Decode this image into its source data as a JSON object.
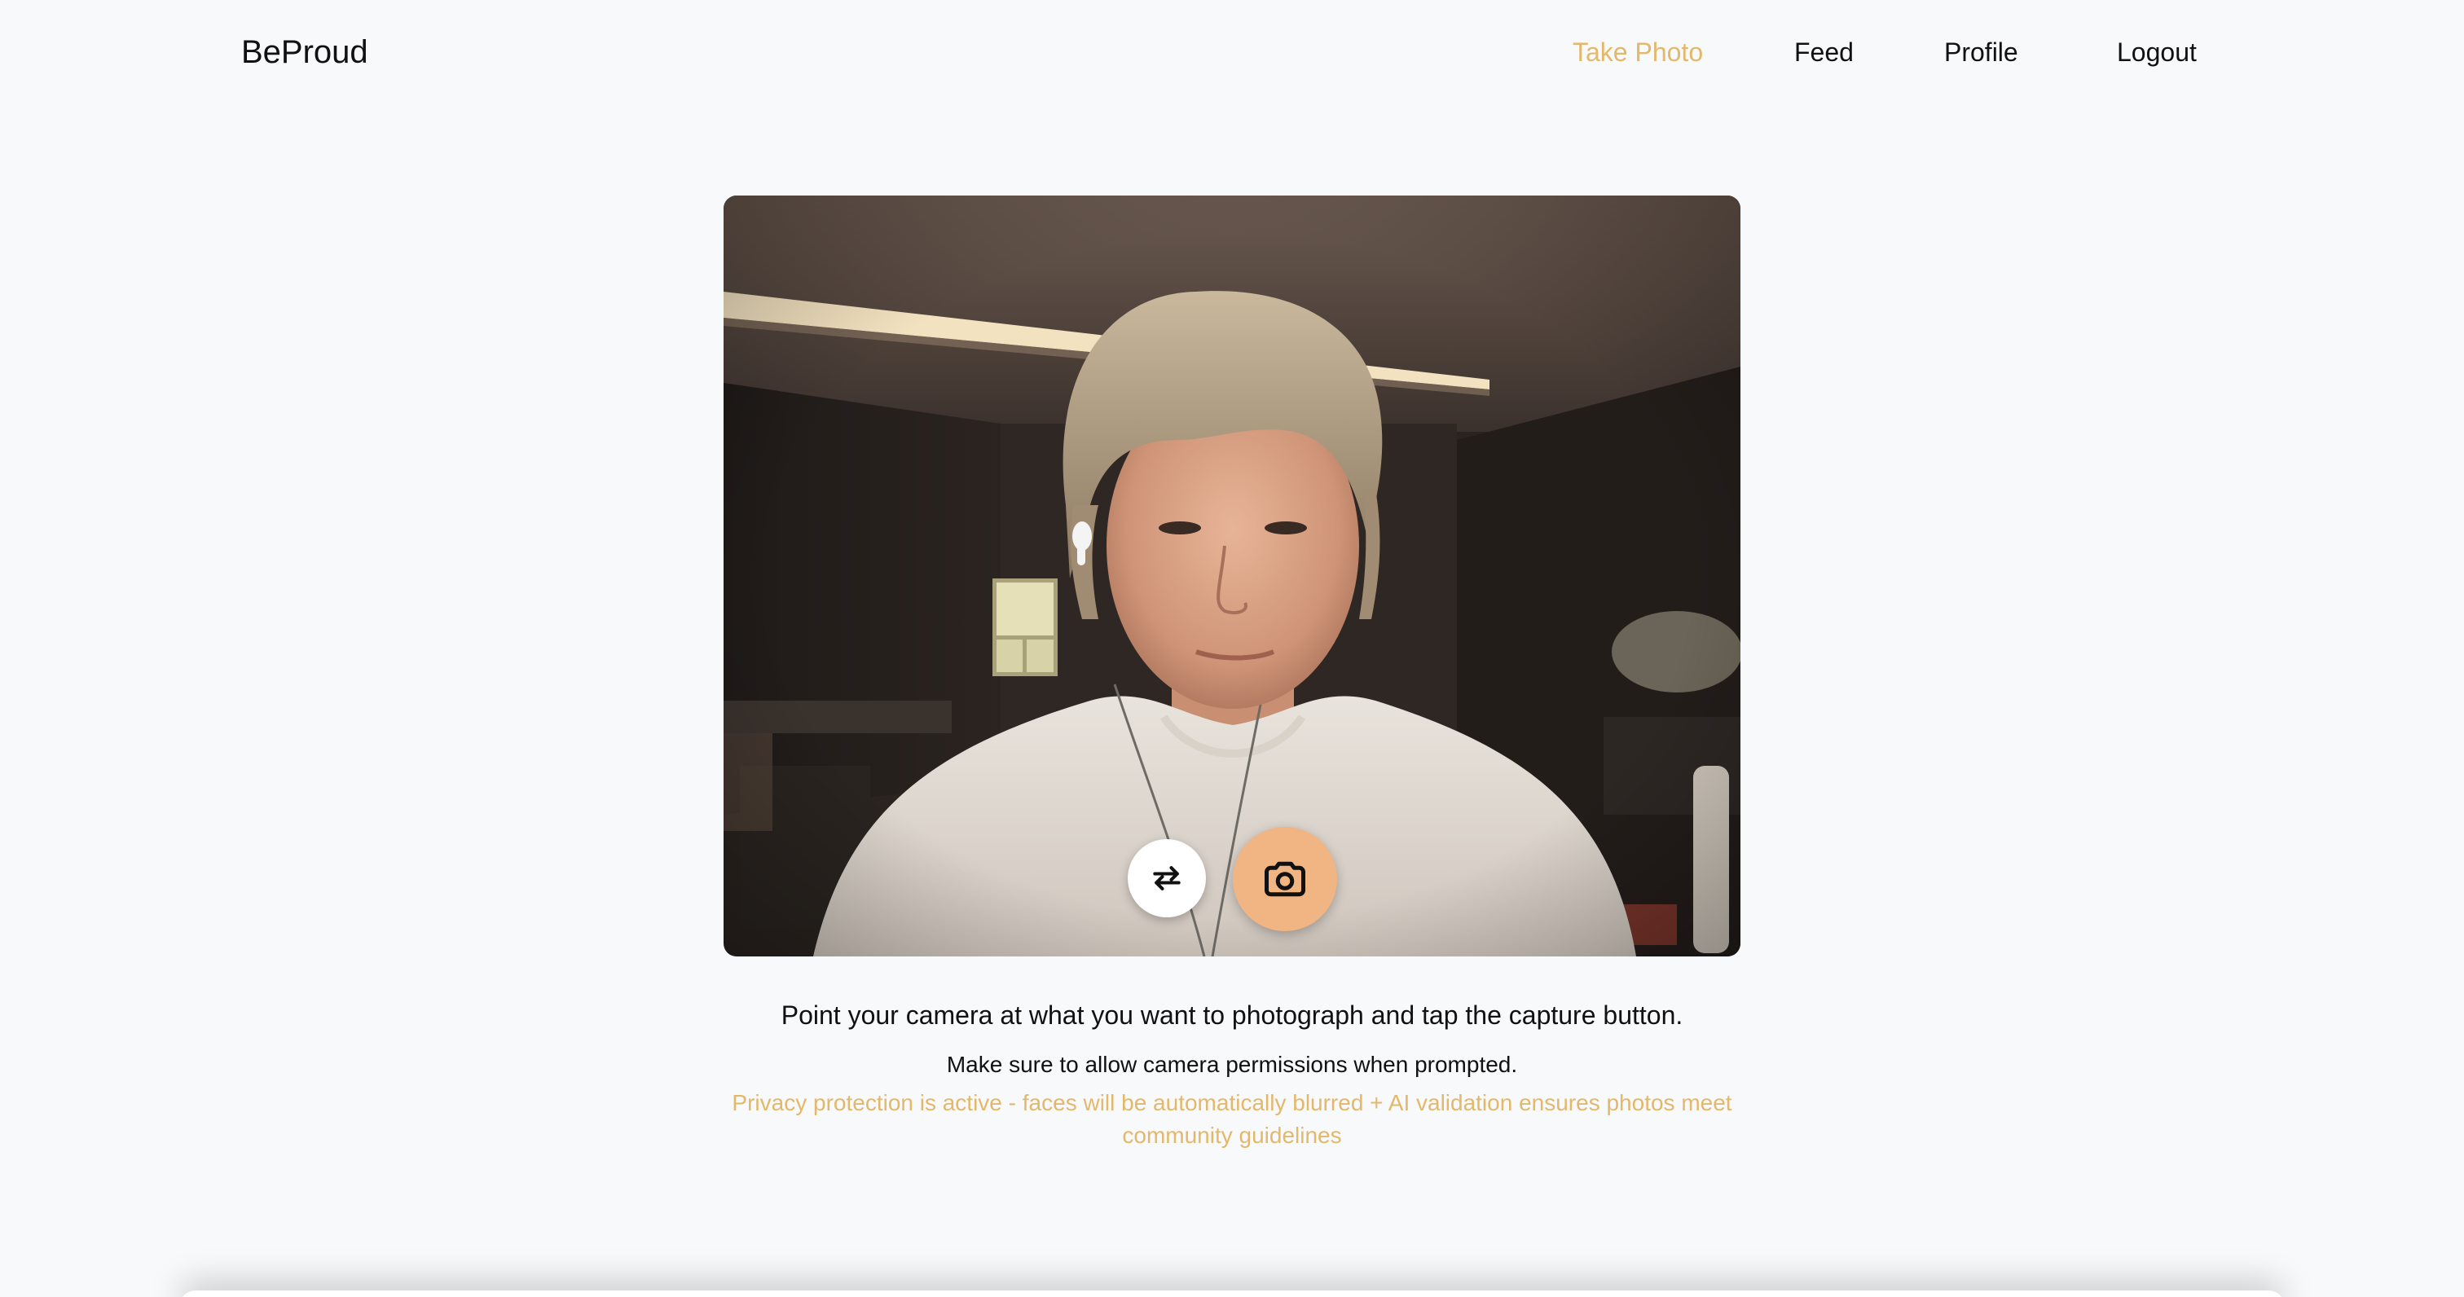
{
  "nav": {
    "brand": "BeProud",
    "links": [
      {
        "label": "Take Photo",
        "active": true
      },
      {
        "label": "Feed",
        "active": false
      },
      {
        "label": "Profile",
        "active": false
      },
      {
        "label": "Logout",
        "active": false
      }
    ]
  },
  "camera": {
    "switch_icon": "switch-camera-icon",
    "capture_icon": "camera-icon"
  },
  "instructions": {
    "main": "Point your camera at what you want to photograph and tap the capture button.",
    "sub": "Make sure to allow camera permissions when prompted.",
    "privacy": "Privacy protection is active - faces will be automatically blurred + AI validation ensures photos meet community guidelines"
  },
  "colors": {
    "accent": "#e3b86b",
    "capture_button": "#f1b583",
    "background": "#f8f9fb"
  }
}
